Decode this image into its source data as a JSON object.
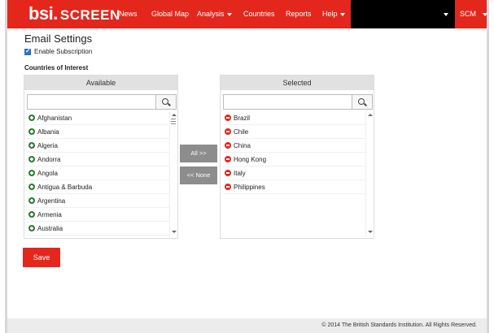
{
  "brand": {
    "logo": "bsi.",
    "product": "SCREEN"
  },
  "nav": {
    "items": [
      "News",
      "Global Map",
      "Analysis",
      "Countries",
      "Reports",
      "Help"
    ],
    "user": "SCM"
  },
  "page": {
    "title": "Email Settings",
    "enable_label": "Enable Subscription",
    "enable_checked": true,
    "countries_label": "Countries of Interest"
  },
  "available": {
    "header": "Available",
    "search_placeholder": "",
    "items": [
      "Afghanistan",
      "Albania",
      "Algeria",
      "Andorra",
      "Angola",
      "Antigua & Barbuda",
      "Argentina",
      "Armenia",
      "Australia"
    ]
  },
  "selected": {
    "header": "Selected",
    "search_placeholder": "",
    "items": [
      "Brazil",
      "Chile",
      "China",
      "Hong Kong",
      "Italy",
      "Philippines"
    ]
  },
  "buttons": {
    "all": "All >>",
    "none": "<< None",
    "save": "Save"
  },
  "footer": "© 2014 The British Standards Institution. All Rights Reserved.",
  "colors": {
    "brand_red": "#e3271d",
    "add_green": "#2e7d32",
    "move_gray": "#8d8d8d"
  },
  "icons": {
    "add": "plus-circle-icon",
    "remove": "minus-circle-icon",
    "search": "search-icon"
  }
}
